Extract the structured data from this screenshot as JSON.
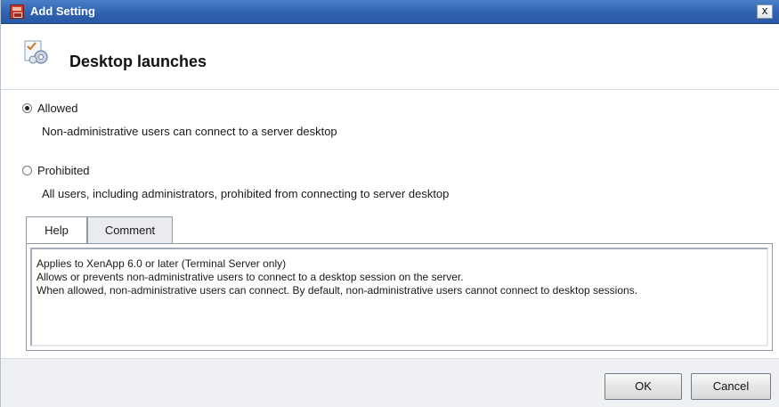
{
  "window": {
    "title": "Add Setting",
    "close_glyph": "x"
  },
  "header": {
    "title": "Desktop launches",
    "icon": "settings-wizard-icon"
  },
  "options": {
    "allowed": {
      "label": "Allowed",
      "description": "Non-administrative users can connect to a server desktop",
      "selected": true
    },
    "prohibited": {
      "label": "Prohibited",
      "description": "All users, including administrators, prohibited from connecting to server desktop",
      "selected": false
    }
  },
  "tabs": {
    "help_label": "Help",
    "comment_label": "Comment",
    "active": "Help"
  },
  "help": {
    "line1": "Applies to XenApp 6.0 or later (Terminal Server only)",
    "line2": "Allows or prevents non-administrative users to connect to a desktop session on the server.",
    "line3": "When allowed, non-administrative users can connect. By default, non-administrative users cannot connect to desktop sessions."
  },
  "buttons": {
    "ok_label": "OK",
    "cancel_label": "Cancel"
  },
  "colors": {
    "titlebar": "#2f62b0",
    "footer": "#eef0f3"
  }
}
